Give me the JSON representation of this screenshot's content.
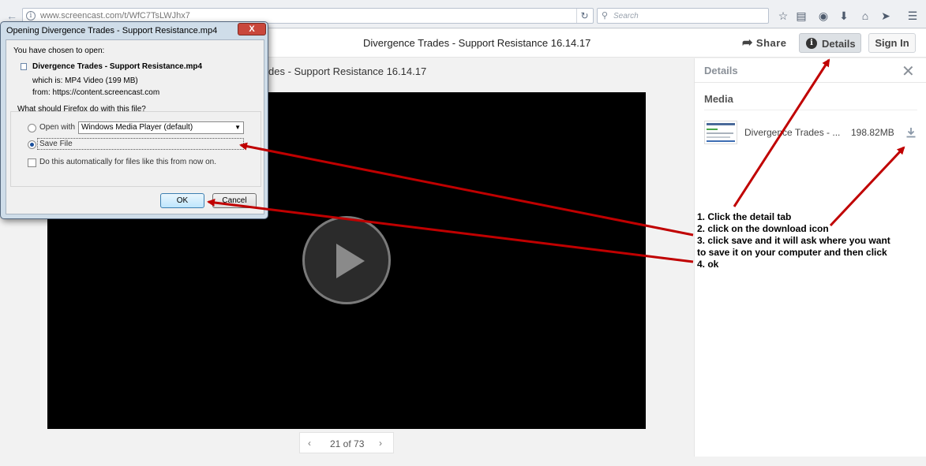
{
  "browser": {
    "url": "www.screencast.com/t/WfC7TsLWJhx7",
    "search_placeholder": "Search"
  },
  "header": {
    "video_title": "Divergence Trades - Support Resistance 16.14.17",
    "share_label": "Share",
    "details_label": "Details",
    "signin_label": "Sign In"
  },
  "main": {
    "subtitle": "des - Support Resistance 16.14.17",
    "pager": {
      "prev": "‹",
      "next": "›",
      "count": "21 of 73"
    }
  },
  "sidebar": {
    "title": "Details",
    "media_heading": "Media",
    "media_name": "Divergence Trades - ...",
    "media_size": "198.82MB"
  },
  "dialog": {
    "title": "Opening Divergence Trades - Support Resistance.mp4",
    "close_label": "X",
    "intro": "You have chosen to open:",
    "filename": "Divergence Trades - Support Resistance.mp4",
    "which_is": "which is:  MP4 Video (199 MB)",
    "from": "from:  https://content.screencast.com",
    "question": "What should Firefox do with this file?",
    "open_with_label": "Open with",
    "open_with_value": "Windows Media Player (default)",
    "save_file_label": "Save File",
    "auto_label": "Do this automatically for files like this from now on.",
    "ok_label": "OK",
    "cancel_label": "Cancel"
  },
  "instructions": [
    "1. Click the detail tab",
    "2. click on the download icon",
    "3. click save and it will ask where you want",
    "to save it on your computer and then click",
    "4. ok"
  ],
  "colors": {
    "arrow": "#c00000",
    "video_bg": "#000000",
    "dialog_frame": "#cfdde9",
    "dialog_close": "#c9473b"
  }
}
